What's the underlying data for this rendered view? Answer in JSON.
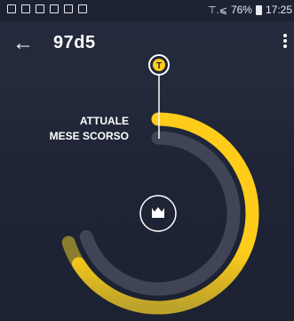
{
  "status_bar": {
    "signal": "⊤.⩽",
    "battery_percent": "76%",
    "time": "17:25",
    "left_icons": [
      "mail-icon",
      "image-icon",
      "grid-icon",
      "flag-icon",
      "bag-icon",
      "photo-icon"
    ]
  },
  "header": {
    "back_icon": "arrow-left-icon",
    "title": "97d5",
    "menu_icon": "more-vert-icon"
  },
  "chart": {
    "current_label": "ATTUALE",
    "previous_label": "MESE SCORSO",
    "marker_badge": "T",
    "center_icon": "crown-icon",
    "current_progress": 0.66,
    "previous_progress": 0.63,
    "colors": {
      "current": "#ffcc1a",
      "current_dim": "#bba22a",
      "previous": "#8a7e2e",
      "track": "#3f4556",
      "background": "#1f2536"
    }
  }
}
